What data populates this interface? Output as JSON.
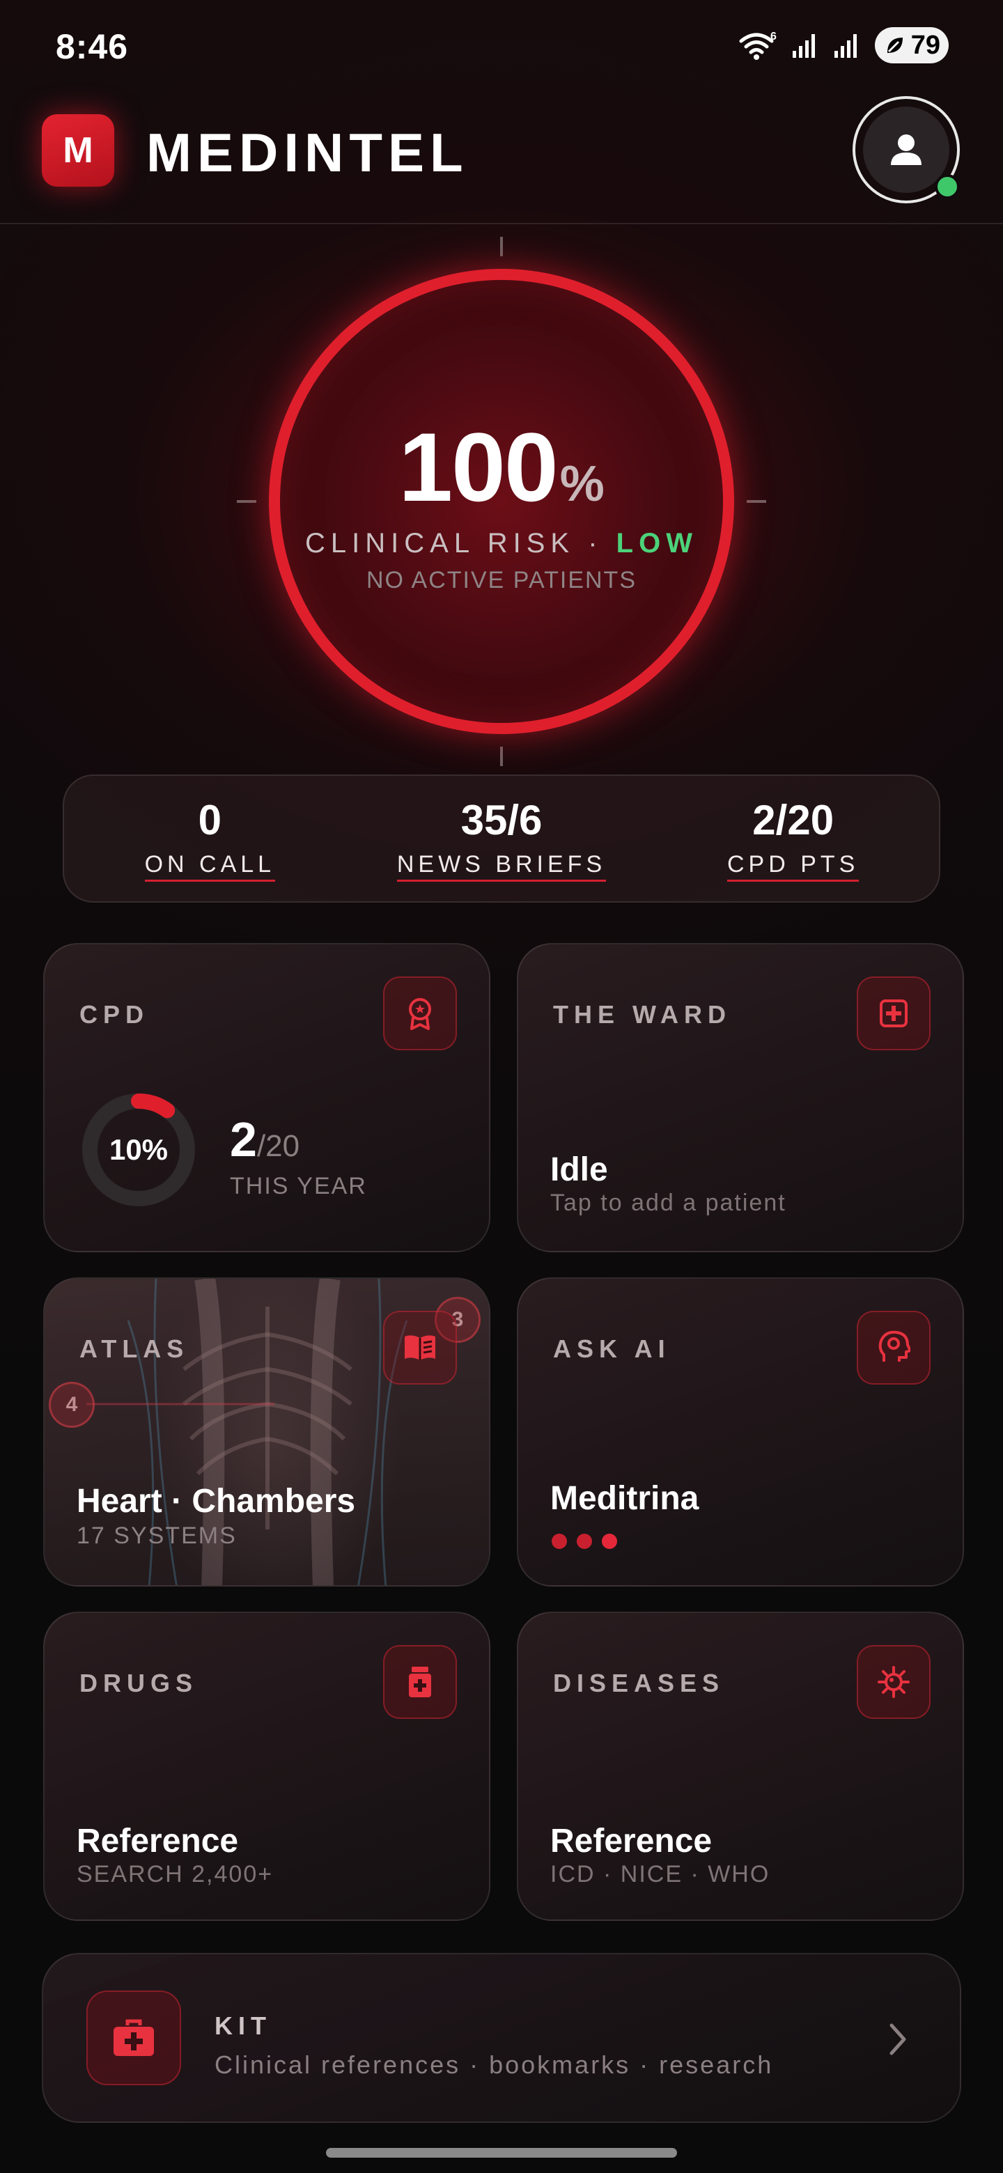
{
  "status_bar": {
    "time": "8:46",
    "battery": "79",
    "wifi_badge": "6"
  },
  "header": {
    "logo_letter": "M",
    "app_name": "MEDINTEL"
  },
  "gauge": {
    "value": "100",
    "unit": "%",
    "label": "CLINICAL RISK ·",
    "level": "LOW",
    "sub": "NO ACTIVE PATIENTS",
    "fill_fraction": 1.0
  },
  "stats": [
    {
      "value": "0",
      "label": "ON CALL"
    },
    {
      "value": "35/6",
      "label": "NEWS BRIEFS"
    },
    {
      "value": "2/20",
      "label": "CPD PTS"
    }
  ],
  "cards": {
    "cpd": {
      "title": "CPD",
      "ring_label": "10%",
      "ring_fraction": 0.1,
      "count": "2",
      "total": "/20",
      "sub": "THIS YEAR",
      "icon": "award-icon"
    },
    "ward": {
      "title": "THE WARD",
      "main": "Idle",
      "sub": "Tap to add a patient",
      "icon": "medical-plus-icon"
    },
    "atlas": {
      "title": "ATLAS",
      "main": "Heart · Chambers",
      "sub": "17 SYSTEMS",
      "marker_a": "4",
      "marker_b": "3",
      "icon": "open-book-icon"
    },
    "ask_ai": {
      "title": "ASK AI",
      "main": "Meditrina",
      "icon": "brain-head-icon"
    },
    "drugs": {
      "title": "DRUGS",
      "main": "Reference",
      "sub": "SEARCH 2,400+",
      "icon": "pill-bottle-icon"
    },
    "diseases": {
      "title": "DISEASES",
      "main": "Reference",
      "sub": "ICD · NICE · WHO",
      "icon": "virus-icon"
    }
  },
  "kit": {
    "title": "KIT",
    "sub": "Clinical references · bookmarks · research",
    "icon": "first-aid-kit-icon"
  },
  "colors": {
    "accent": "#e01f2d",
    "ok": "#4cd37a",
    "background": "#0d0a0b"
  }
}
